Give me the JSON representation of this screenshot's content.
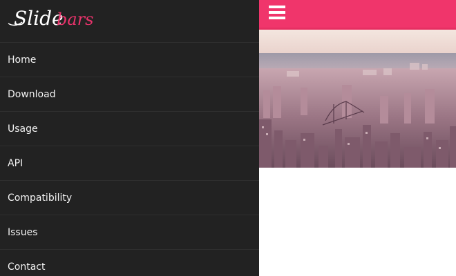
{
  "logo": {
    "part1": "Slide",
    "part2": "bars"
  },
  "menu": [
    {
      "label": "Home"
    },
    {
      "label": "Download"
    },
    {
      "label": "Usage"
    },
    {
      "label": "API"
    },
    {
      "label": "Compatibility"
    },
    {
      "label": "Issues"
    },
    {
      "label": "Contact"
    }
  ],
  "topbar": {
    "menu_icon": "hamburger-icon"
  },
  "colors": {
    "sidebar_bg": "#222222",
    "accent": "#f0356b",
    "logo_accent": "#e8336b",
    "menu_text": "#f2f2f2"
  }
}
